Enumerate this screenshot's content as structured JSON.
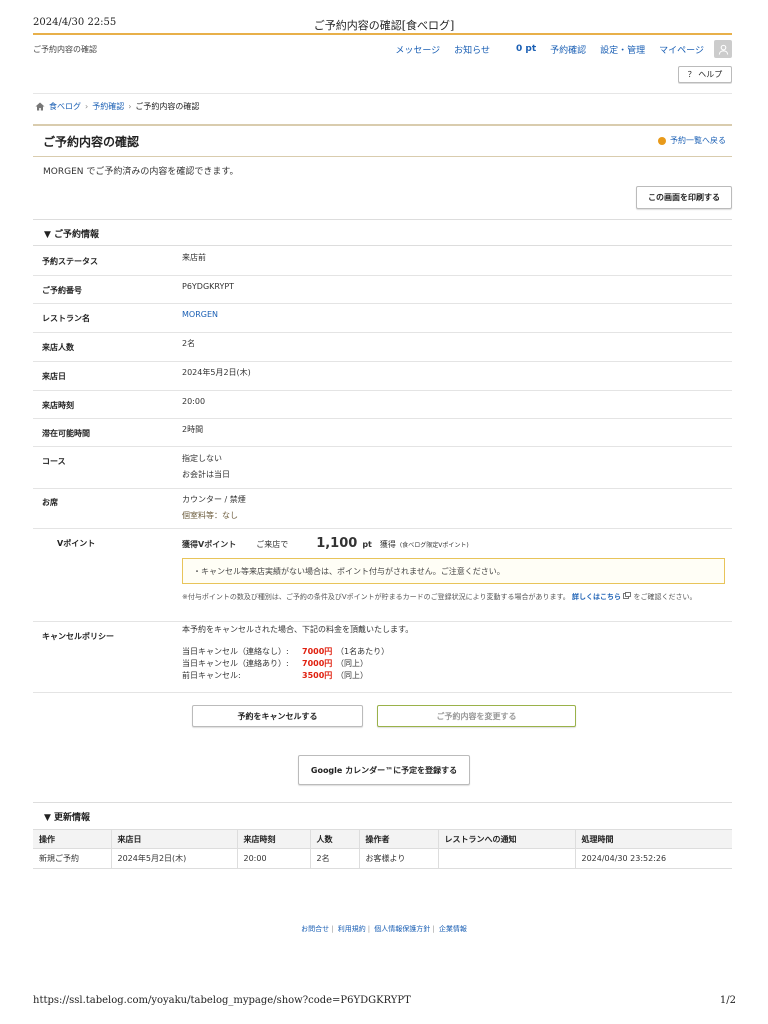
{
  "print": {
    "datetime": "2024/4/30 22:55",
    "doc_title": "ご予約内容の確認[食べログ]",
    "url": "https://ssl.tabelog.com/yoyaku/tabelog_mypage/show?code=P6YDGKRYPT",
    "page": "1/2"
  },
  "header": {
    "page_label": "ご予約内容の確認",
    "nav": [
      "メッセージ",
      "お知らせ"
    ],
    "points": "0 pt",
    "nav2": [
      "予約確認",
      "設定・管理",
      "マイページ"
    ],
    "help": "？ ヘルプ"
  },
  "breadcrumb": [
    "食べログ",
    "予約確認",
    "ご予約内容の確認"
  ],
  "page": {
    "title": "ご予約内容の確認",
    "back_link": "予約一覧へ戻る",
    "intro": "MORGEN でご予約済みの内容を確認できます。",
    "print_button": "この画面を印刷する"
  },
  "reservation": {
    "section_title": "▼ ご予約情報",
    "status_label": "予約ステータス",
    "status": "来店前",
    "number_label": "ご予約番号",
    "number": "P6YDGKRYPT",
    "restaurant_label": "レストラン名",
    "restaurant": "MORGEN",
    "party_label": "来店人数",
    "party": "2名",
    "date_label": "来店日",
    "date": "2024年5月2日(木)",
    "time_label": "来店時刻",
    "time": "20:00",
    "stay_label": "滞在可能時間",
    "stay": "2時間",
    "course_label": "コース",
    "course": "指定しない",
    "course_sub": "お会計は当日",
    "seat_label": "お席",
    "seat": "カウンター / 禁煙",
    "seat_sub": "個室料等：なし",
    "vpoint_label": "Vポイント",
    "vpoint_earn": "獲得Vポイント",
    "vpoint_when": "ご来店で",
    "vpoint_value": "1,100",
    "vpoint_unit": "pt",
    "vpoint_get": "獲得",
    "vpoint_note_small": "(食べログ限定Vポイント)",
    "vpoint_warning": "・キャンセル等来店実績がない場合は、ポイント付与がされません。ご注意ください。",
    "vpoint_disclaimer": "※付与ポイントの数及び種別は、ご予約の条件及びVポイントが貯まるカードのご登録状況により変動する場合があります。",
    "vpoint_detail_link": "詳しくはこちら",
    "vpoint_disclaimer_end": "をご確認ください。",
    "cancel_label": "キャンセルポリシー",
    "cancel_intro": "本予約をキャンセルされた場合、下記の料金を頂戴いたします。",
    "cancel_rows": [
      {
        "label": "当日キャンセル（連絡なし）:",
        "fee": "7000円",
        "note": "（1名あたり）"
      },
      {
        "label": "当日キャンセル（連絡あり）:",
        "fee": "7000円",
        "note": "（同上）"
      },
      {
        "label": "前日キャンセル:",
        "fee": "3500円",
        "note": "（同上）"
      }
    ]
  },
  "actions": {
    "cancel_button": "予約をキャンセルする",
    "change_button": "ご予約内容を変更する",
    "calendar_button": "Google カレンダー™に予定を登録する"
  },
  "updates": {
    "section_title": "▼ 更新情報",
    "headers": [
      "操作",
      "来店日",
      "来店時刻",
      "人数",
      "操作者",
      "レストランへの通知",
      "処理時間"
    ],
    "rows": [
      [
        "新規ご予約",
        "2024年5月2日(木)",
        "20:00",
        "2名",
        "お客様より",
        "",
        "2024/04/30 23:52:26"
      ]
    ]
  },
  "footer": {
    "links": [
      "お問合せ",
      "利用規約",
      "個人情報保護方針",
      "企業情報"
    ]
  },
  "colors": {
    "accent_bar": "#e8b04a",
    "link": "#1a5fb4",
    "fee_red": "#e0200f"
  }
}
